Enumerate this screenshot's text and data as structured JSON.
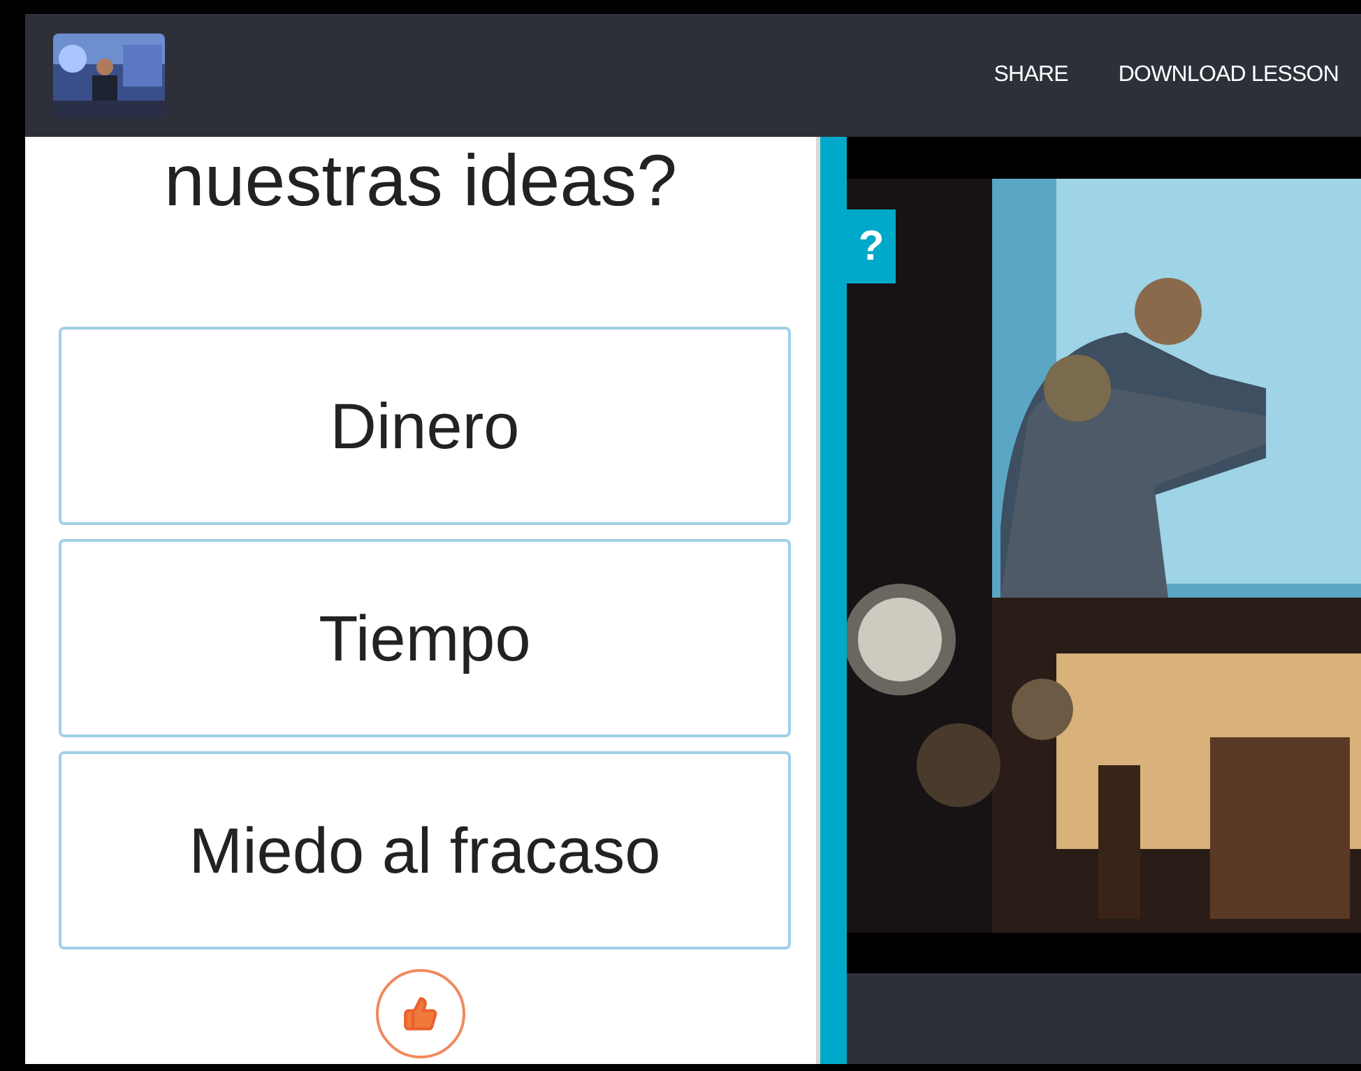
{
  "header": {
    "logo": {
      "kind": "picture"
    },
    "links": [
      "SHARE",
      "DOWNLOAD LESSON"
    ]
  },
  "question": {
    "text": "nuestras ideas?"
  },
  "answers": [
    {
      "label": "Dinero"
    },
    {
      "label": "Tiempo"
    },
    {
      "label": "Miedo al fracaso"
    }
  ],
  "help_tab": {
    "label": "?"
  },
  "video": {
    "kind": "picture"
  }
}
